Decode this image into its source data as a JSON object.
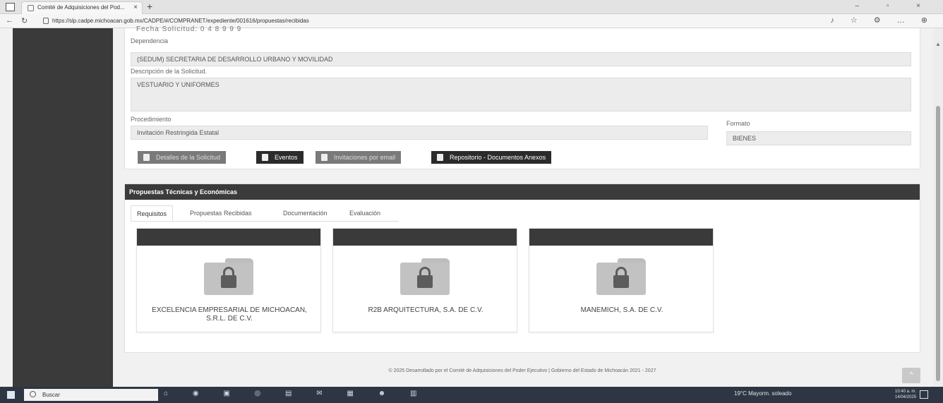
{
  "browser": {
    "tab_title": "Comité de Adquisiciones del Pod...",
    "tab_close": "×",
    "new_tab": "+",
    "url": "https://slp.cadpe.michoacan.gob.mx/CADPE/#/COMPRANET/expediente/001616/propuestas/recibidas",
    "window_controls": "– ▫ ×",
    "toolbar_icons": "♪ ☆ ⚙ … ⊕"
  },
  "header_cut": "Fecha Solicitud: 0 4 8 9 9 9",
  "form": {
    "dependencia_label": "Dependencia",
    "dependencia_value": "(SEDUM) SECRETARIA DE DESARROLLO URBANO Y MOVILIDAD",
    "descripcion_label": "Descripción de la Solicitud.",
    "descripcion_value": "VESTUARIO Y UNIFORMES",
    "procedimiento_label": "Procedimiento",
    "procedimiento_value": "Invitación Restringida Estatal",
    "formato_label": "Formato",
    "formato_value": "BIENES"
  },
  "buttons": {
    "detalles": "Detalles de la Solicitud",
    "eventos": "Eventos",
    "invitaciones": "Invitaciones por email",
    "repositorio": "Repositorio - Documentos Anexos"
  },
  "propuestas": {
    "title": "Propuestas Técnicas y Económicas",
    "tabs": [
      "Requisitos",
      "Propuestas Recibidas",
      "Documentación",
      "Evaluación"
    ],
    "cards": [
      {
        "name": "EXCELENCIA EMPRESARIAL DE MICHOACAN, S.R.L. DE C.V."
      },
      {
        "name": "R2B ARQUITECTURA, S.A. DE C.V."
      },
      {
        "name": "MANEMICH, S.A. DE C.V."
      }
    ]
  },
  "footer": "© 2025 Desarrollado por el Comité de Adquisiciones del Poder Ejecutivo | Gobierno del Estado de Michoacán 2021 - 2027",
  "back_to_top": "^",
  "taskbar": {
    "search_placeholder": "Buscar",
    "weather": "19°C Mayorm. soleado",
    "time": "10:40 a. m.",
    "date": "14/04/2025"
  }
}
